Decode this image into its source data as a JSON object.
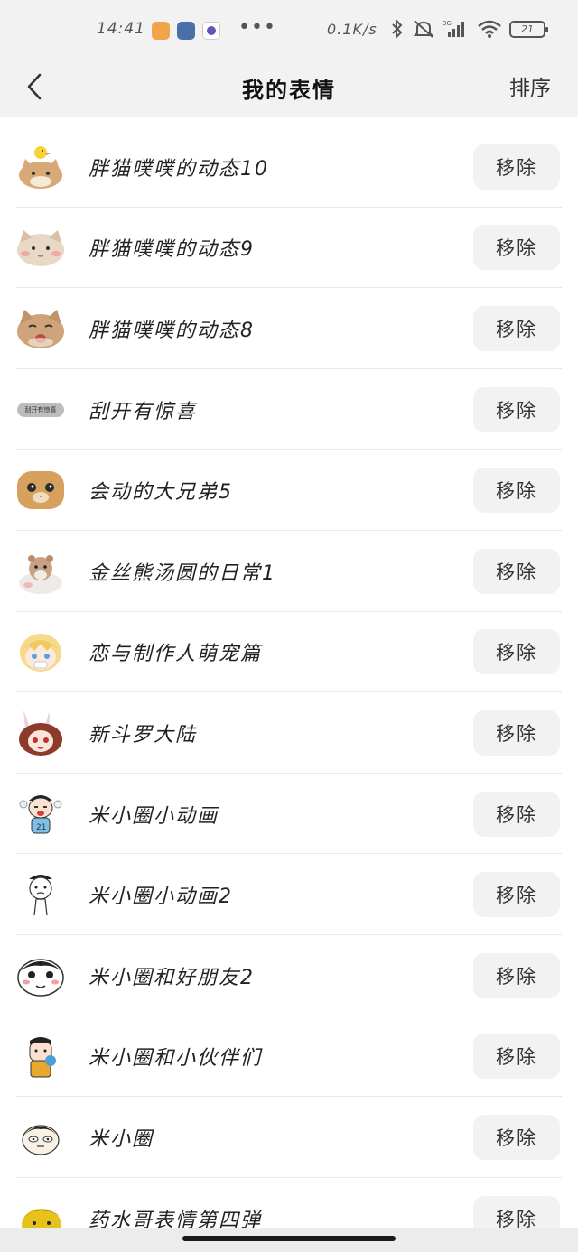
{
  "status_bar": {
    "time": "14:41",
    "more": "•••",
    "speed": "0.1K/s",
    "network": "3G",
    "battery": "21"
  },
  "header": {
    "title": "我的表情",
    "sort_label": "排序"
  },
  "remove_label": "移除",
  "items": [
    {
      "name": "胖猫噗噗的动态10",
      "icon": "cat-with-duck-icon"
    },
    {
      "name": "胖猫噗噗的动态9",
      "icon": "blushing-cat-icon"
    },
    {
      "name": "胖猫噗噗的动态8",
      "icon": "laughing-cat-icon"
    },
    {
      "name": "刮开有惊喜",
      "icon": "scratch-card-icon",
      "thumb_text": "刮开有惊喜"
    },
    {
      "name": "会动的大兄弟5",
      "icon": "chubby-cat-icon"
    },
    {
      "name": "金丝熊汤圆的日常1",
      "icon": "hamster-icon"
    },
    {
      "name": "恋与制作人萌宠篇",
      "icon": "blonde-chibi-icon"
    },
    {
      "name": "新斗罗大陆",
      "icon": "bunny-girl-icon"
    },
    {
      "name": "米小圈小动画",
      "icon": "crying-boy-icon"
    },
    {
      "name": "米小圈小动画2",
      "icon": "cartoon-boy-icon"
    },
    {
      "name": "米小圈和好朋友2",
      "icon": "round-face-icon"
    },
    {
      "name": "米小圈和小伙伴们",
      "icon": "boy-eating-icon"
    },
    {
      "name": "米小圈",
      "icon": "sleepy-face-icon"
    },
    {
      "name": "药水哥表情第四弹",
      "icon": "yellow-face-icon"
    }
  ],
  "colors": {
    "header_bg": "#f2f2f2",
    "button_bg": "#f2f2f2",
    "divider": "#e8e8e8"
  }
}
